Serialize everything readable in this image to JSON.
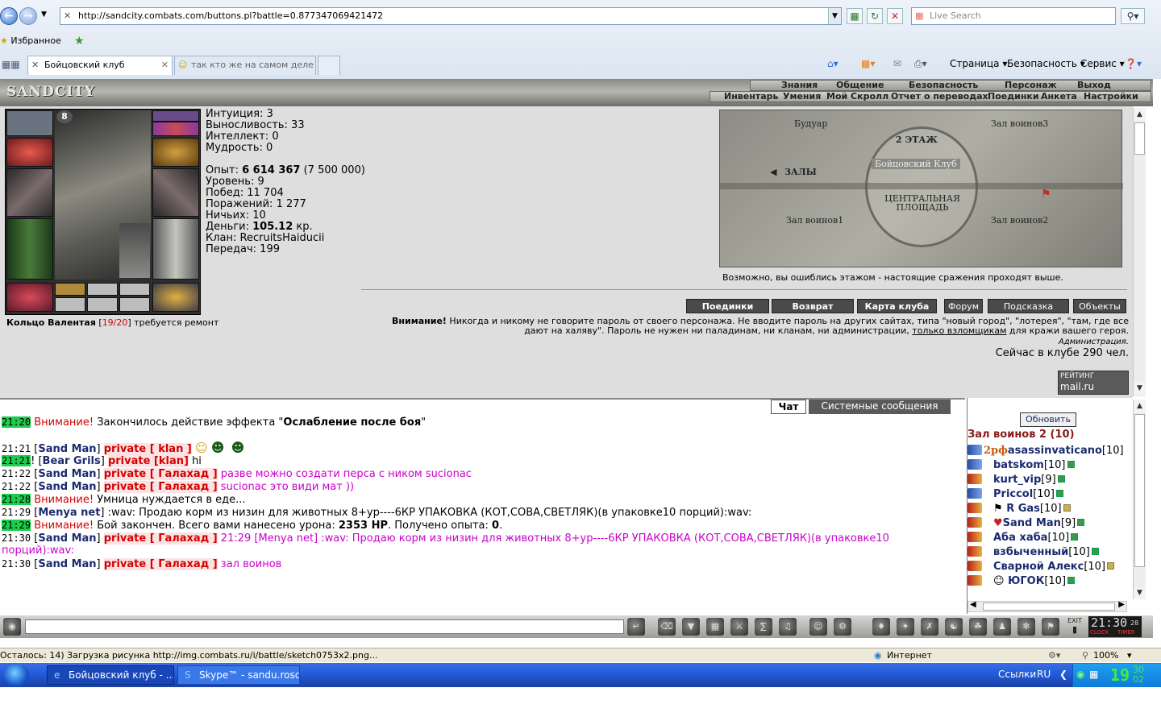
{
  "browser": {
    "url": "http://sandcity.combats.com/buttons.pl?battle=0.877347069421472",
    "search_placeholder": "Live Search",
    "favorites_label": "Избранное",
    "tabs": [
      {
        "label": "Бойцовский клуб"
      },
      {
        "label": "так кто же на самом деле с..."
      }
    ],
    "commands": {
      "page": "Страница",
      "security": "Безопасность",
      "service": "Сервис"
    },
    "status_text": "Осталось: 14) Загрузка рисунка http://img.combats.ru/i/battle/sketch0753x2.png...",
    "zone": "Интернет",
    "zoom": "100%"
  },
  "game": {
    "logo": "SANDCITY",
    "top_nav": [
      "Знания",
      "Общение",
      "Безопасность",
      "Персонаж",
      "Выход"
    ],
    "sub_nav": [
      "Инвентарь",
      "Умения",
      "Мой Скролл",
      "Отчет о переводах",
      "Поединки",
      "Анкета",
      "Настройки"
    ],
    "character": {
      "level_badge": "8",
      "stats_top": [
        "Интуиция: 3",
        "Выносливость: 33",
        "Интеллект: 0",
        "Мудрость: 0"
      ],
      "exp_label": "Опыт: ",
      "exp_value": "6 614 367",
      "exp_next": " (7 500 000)",
      "level": "Уровень: 9",
      "wins": "Побед: 11 704",
      "losses": "Поражений: 1 277",
      "draws": "Ничьих: 10",
      "money_label": "Деньги: ",
      "money_value": "105.12",
      "money_unit": " кр.",
      "clan": "Клан: RecruitsHaiducii",
      "transfers": "Передач: 199",
      "item_name": "Кольцо Валентая",
      "item_durability": "19/20",
      "item_note": " требуется ремонт"
    },
    "map": {
      "labels": {
        "boudoir": "Будуар",
        "warriors3": "Зал воинов3",
        "floor": "2 ЭТАЖ",
        "club": "Бойцовский Клуб",
        "halls": "ЗАЛЫ",
        "central": "ЦЕНТРАЛЬНАЯ ПЛОЩАДЬ",
        "warriors1": "Зал воинов1",
        "warriors2": "Зал воинов2"
      },
      "note": "Возможно, вы ошиблись этажом - настоящие сражения проходят выше."
    },
    "buttons": [
      "Поединки",
      "Возврат",
      "Карта клуба",
      "Форум",
      "Подсказка",
      "Объекты"
    ],
    "warning_label": "Внимание!",
    "warning_text": " Никогда и никому не говорите пароль от своего персонажа. Не вводите пароль на других сайтах, типа \"новый город\", \"лотерея\", \"там, где все дают на халяву\". Пароль не нужен ни паладинам, ни кланам, ни администрации, ",
    "warning_link": "только взломщикам",
    "warning_tail": " для кражи вашего героя.",
    "admin_sign": "Администрация.",
    "online": "Сейчас в клубе 290 чел.",
    "rating_label": "РЕЙТИНГ",
    "rating_site": "mail.ru"
  },
  "chat": {
    "tabs": [
      "Чат",
      "Системные сообщения"
    ],
    "lines": [
      {
        "time": "21:20",
        "a": "Внимание!",
        "b": " Закончилось действие эффекта \"",
        "c": "Ослабление после боя",
        "d": "\""
      },
      {
        "time": "21:21",
        "nick": "Sand Man",
        "to": "private [ klan ]"
      },
      {
        "time": "21:21",
        "nick": "Bear Grils",
        "to": "private [klan]",
        "msg": " hi"
      },
      {
        "time": "21:22",
        "nick": "Sand Man",
        "to": "private [ Галахад ]",
        "msg": " разве можно создати перса с ником sucionac"
      },
      {
        "time": "21:22",
        "nick": "Sand Man",
        "to": "private [ Галахад ]",
        "msg": " sucionac это види мат ))"
      },
      {
        "time": "21:28",
        "a": "Внимание!",
        "b": " Умница нуждается в еде..."
      },
      {
        "time": "21:29",
        "nick": "Menya net",
        "msg": " :wav: Продаю корм из низин для животных 8+ур----6КР УПАКОВКА (КОТ,СОВА,СВЕТЛЯК)(в упаковке10 порций):wav:"
      },
      {
        "time": "21:29",
        "a": "Внимание!",
        "b": " Бой закончен. Всего вами нанесено урона: ",
        "c": "2353 HP",
        "d": ". Получено опыта: ",
        "e": "0",
        "f": "."
      },
      {
        "time": "21:30",
        "nick": "Sand Man",
        "to": "private [ Галахад ]",
        "msg": " 21:29 [Menya net] :wav: Продаю корм из низин для животных 8+ур----6КР УПАКОВКА (КОТ,СОВА,СВЕТЛЯК)(в упаковке10",
        "msg2": "порций):wav:"
      },
      {
        "time": "21:30",
        "nick": "Sand Man",
        "to": "private [ Галахад ]",
        "msg": " зал воинов"
      }
    ],
    "refresh": "Обновить",
    "room": "Зал воинов 2 (10)",
    "users": [
      {
        "name": "asassinvaticano",
        "lvl": "[10]",
        "clan": "2pф"
      },
      {
        "name": "batskom",
        "lvl": "[10]"
      },
      {
        "name": "kurt_vip",
        "lvl": "[9]"
      },
      {
        "name": "Priccol",
        "lvl": "[10]"
      },
      {
        "name": "R Gas",
        "lvl": "[10]"
      },
      {
        "name": "Sand Man",
        "lvl": "[9]"
      },
      {
        "name": "Аба хаба",
        "lvl": "[10]"
      },
      {
        "name": "взбыченный",
        "lvl": "[10]"
      },
      {
        "name": "Сварной Алекс",
        "lvl": "[10]"
      },
      {
        "name": "ЮГОК",
        "lvl": "[10]"
      }
    ],
    "clock": "21:30",
    "clock_sec": "28",
    "clock_btn": "CLOCK",
    "timer_btn": "TIMER",
    "exit_btn": "EXIT"
  },
  "taskbar": {
    "items": [
      "Бойцовский клуб - ...",
      "Skype™ - sandu.rosc..."
    ],
    "links": "Ссылки",
    "lang": "RU",
    "time": "19",
    "time_min": "30",
    "time_sec": "02"
  }
}
